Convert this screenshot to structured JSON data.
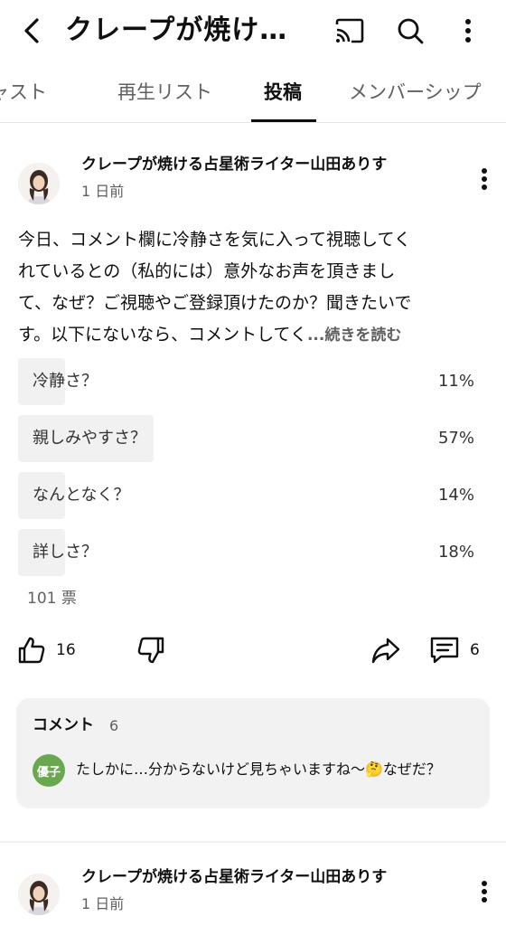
{
  "header": {
    "title": "クレープが焼け…",
    "back_icon": "chevron-left-icon",
    "cast_icon": "cast-icon",
    "search_icon": "search-icon",
    "more_icon": "more-vertical-icon"
  },
  "tabs": [
    {
      "label": "ポッドキャスト",
      "active": false
    },
    {
      "label": "再生リスト",
      "active": false
    },
    {
      "label": "投稿",
      "active": true
    },
    {
      "label": "メンバーシップ",
      "active": false
    }
  ],
  "post": {
    "channel_name": "クレープが焼ける占星術ライター山田ありす",
    "time": "1 日前",
    "body_lines": [
      "今日、コメント欄に冷静さを気に入って視聴してく",
      "れているとの（私的には）意外なお声を頂きまし",
      "て、なぜ？ご視聴やご登録頂けたのか？聞きたいで",
      "す。以下にないなら、コメントしてく"
    ],
    "read_more": "...続きを読む",
    "poll": {
      "options": [
        {
          "label": "冷静さ？",
          "percent": "11%",
          "value": 11
        },
        {
          "label": "親しみやすさ？",
          "percent": "57%",
          "value": 57
        },
        {
          "label": "なんとなく？",
          "percent": "14%",
          "value": 14
        },
        {
          "label": "詳しさ？",
          "percent": "18%",
          "value": 18
        }
      ],
      "votes": "101 票"
    },
    "likes": "16",
    "comment_count": "6",
    "comments": {
      "title": "コメント",
      "count": "6",
      "commenter_initials": "優子",
      "commenter_color": "#6aa84f",
      "top_comment": "たしかに…分からないけど見ちゃいますね〜🤔なぜだ？"
    }
  },
  "post2": {
    "channel_name": "クレープが焼ける占星術ライター山田ありす",
    "time": "1 日前"
  }
}
